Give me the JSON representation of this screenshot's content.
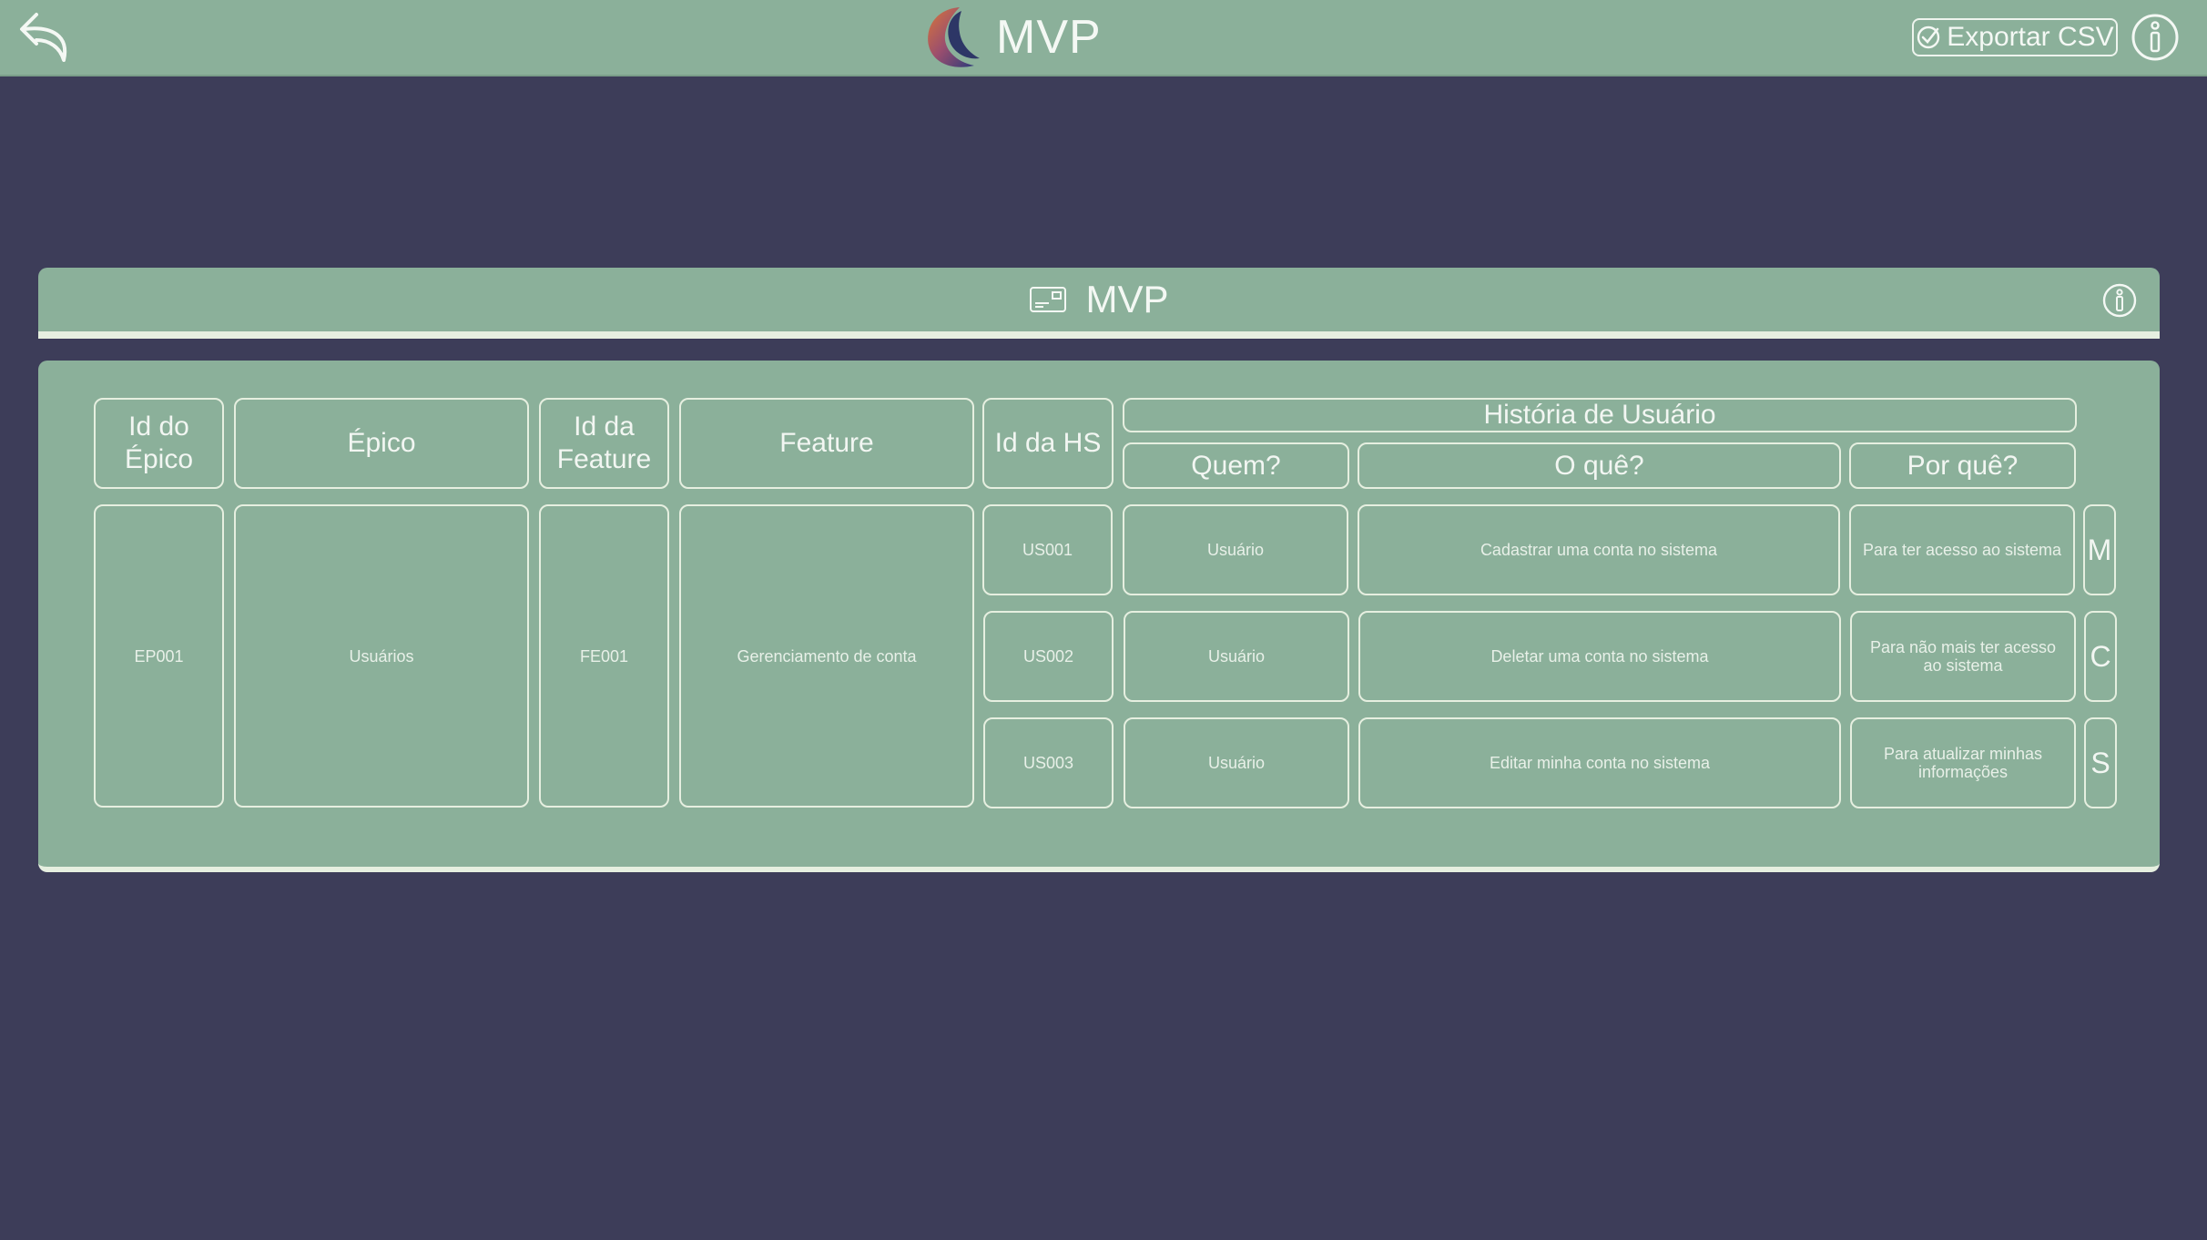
{
  "app": {
    "title": "MVP",
    "export_label": "Exportar CSV",
    "icons": {
      "back": "back-arrow-icon",
      "logo": "crescent-logo",
      "export": "check-circle-icon",
      "info": "info-icon",
      "card": "card-icon"
    }
  },
  "section": {
    "title": "MVP"
  },
  "table": {
    "headers": {
      "epic_id": "Id do Épico",
      "epic": "Épico",
      "feature_id": "Id da Feature",
      "feature": "Feature",
      "hs_id": "Id da HS",
      "user_story": "História de Usuário",
      "who": "Quem?",
      "what": "O quê?",
      "why": "Por quê?"
    },
    "group": {
      "epic_id": "EP001",
      "epic": "Usuários",
      "feature_id": "FE001",
      "feature": "Gerenciamento de conta"
    },
    "stories": [
      {
        "id": "US001",
        "who": "Usuário",
        "what": "Cadastrar uma conta no sistema",
        "why": "Para ter acesso ao sistema",
        "priority": "M"
      },
      {
        "id": "US002",
        "who": "Usuário",
        "what": "Deletar uma conta no sistema",
        "why": "Para não mais ter acesso ao sistema",
        "priority": "C"
      },
      {
        "id": "US003",
        "who": "Usuário",
        "what": "Editar minha conta no sistema",
        "why": "Para atualizar minhas informações",
        "priority": "S"
      }
    ]
  },
  "colors": {
    "background": "#3d3d59",
    "surface": "#8bb09a",
    "line": "#e6efe0"
  }
}
